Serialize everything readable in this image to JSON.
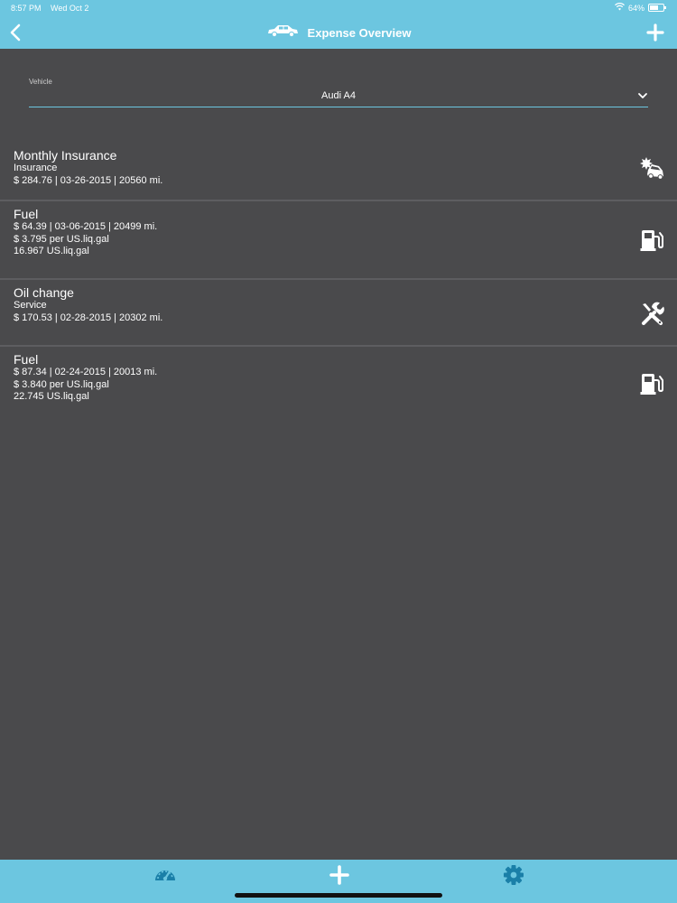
{
  "status": {
    "time": "8:57 PM",
    "date": "Wed Oct 2",
    "battery": "64%",
    "battery_level": 0.64
  },
  "nav": {
    "title": "Expense Overview",
    "back_icon": "chevron-left-icon",
    "add_icon": "plus-icon",
    "car_icon": "car-icon"
  },
  "vehicle": {
    "label": "Vehicle",
    "value": "Audi A4"
  },
  "expenses": [
    {
      "title": "Monthly Insurance",
      "lines": [
        "Insurance",
        "$ 284.76 | 03-26-2015 | 20560 mi."
      ],
      "icon": "car-crash-icon"
    },
    {
      "title": "Fuel",
      "lines": [
        "$ 64.39 | 03-06-2015 | 20499 mi.",
        "$ 3.795 per US.liq.gal",
        "16.967 US.liq.gal"
      ],
      "icon": "fuel-pump-icon"
    },
    {
      "title": "Oil change",
      "lines": [
        "Service",
        "$ 170.53 | 02-28-2015 | 20302 mi."
      ],
      "icon": "tools-icon"
    },
    {
      "title": "Fuel",
      "lines": [
        "$ 87.34 | 02-24-2015 | 20013 mi.",
        "$ 3.840 per US.liq.gal",
        "22.745 US.liq.gal"
      ],
      "icon": "fuel-pump-icon"
    }
  ],
  "tabbar": {
    "tabs": [
      "dashboard-icon",
      "plus-icon",
      "gear-icon"
    ]
  },
  "colors": {
    "accent": "#6cc6e0",
    "background": "#4a4a4c",
    "tab_icon": "#1a7fa8"
  }
}
